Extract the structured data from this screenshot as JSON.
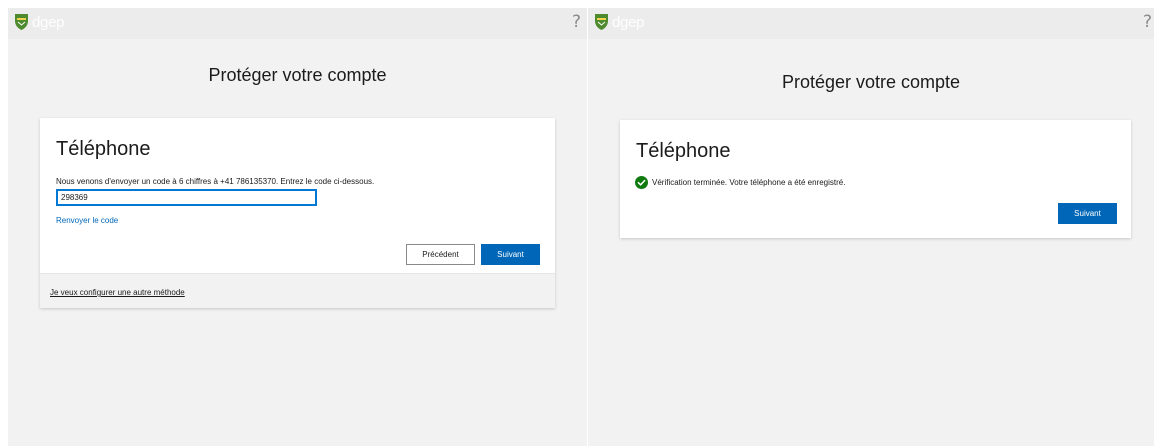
{
  "left_panel": {
    "header": {
      "logo_text": "dgep",
      "help_label": "?"
    },
    "page_title": "Protéger votre compte",
    "card": {
      "title": "Téléphone",
      "instruction": "Nous venons d'envoyer un code à 6 chiffres à +41 786135370. Entrez le code ci-dessous.",
      "code_value": "298369",
      "resend_label": "Renvoyer le code",
      "back_label": "Précédent",
      "next_label": "Suivant",
      "other_method_label": "Je veux configurer une autre méthode"
    }
  },
  "right_panel": {
    "header": {
      "logo_text": "dgep",
      "help_label": "?"
    },
    "page_title": "Protéger votre compte",
    "card": {
      "title": "Téléphone",
      "success_message": "Vérification terminée. Votre téléphone a été enregistré.",
      "next_label": "Suivant"
    }
  },
  "colors": {
    "accent": "#0067b8",
    "success": "#107c10",
    "background": "#f2f2f2",
    "shield_green": "#4e8a2e"
  },
  "icons": {
    "logo": "shield-logo-icon",
    "help": "help-icon",
    "success": "check-circle-icon"
  }
}
